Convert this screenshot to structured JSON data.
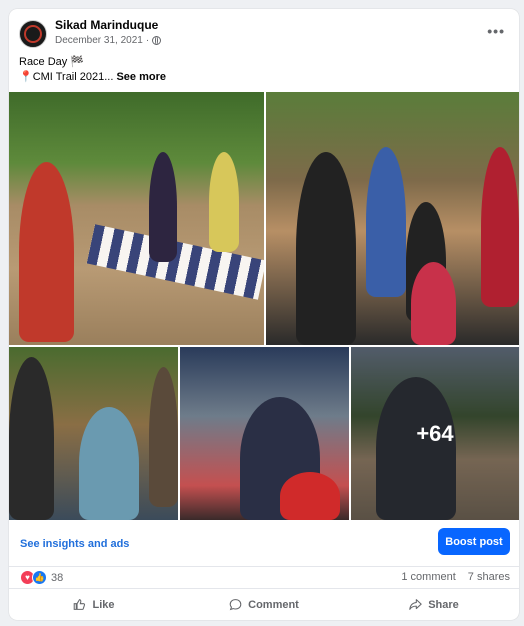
{
  "post": {
    "page_name": "Sikad Marinduque",
    "date": "December 31, 2021",
    "separator": "·",
    "more_options": "•••",
    "line1": "Race Day 🏁",
    "line2": "📍CMI Trail 2021...",
    "see_more": "See more"
  },
  "photos": {
    "extra_count": "+64"
  },
  "actions": {
    "insights": "See insights and ads",
    "boost": "Boost post"
  },
  "stats": {
    "reaction_count": "38",
    "comments": "1 comment",
    "shares": "7 shares"
  },
  "buttons": {
    "like": "Like",
    "comment": "Comment",
    "share": "Share"
  },
  "colors": {
    "accent": "#0866ff",
    "love": "#f33e58",
    "like": "#1877f2"
  }
}
